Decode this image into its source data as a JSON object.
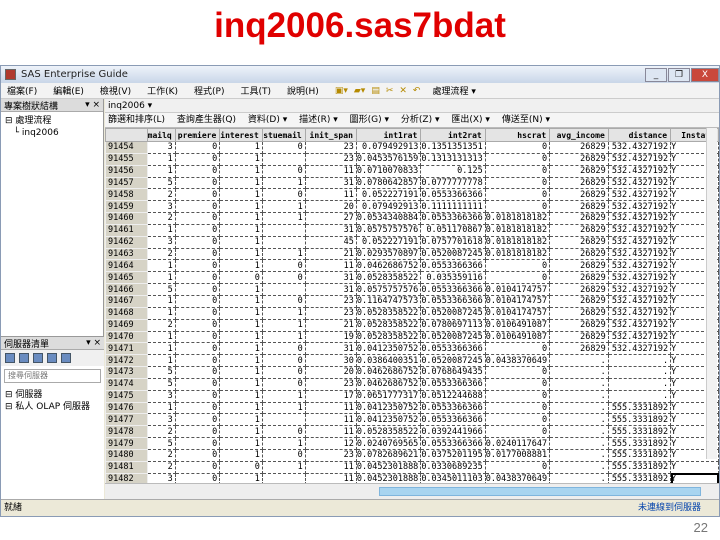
{
  "slide": {
    "title": "inq2006.sas7bdat",
    "page": "22"
  },
  "window": {
    "title": "SAS Enterprise Guide",
    "min": "_",
    "restore": "❐",
    "close": "X"
  },
  "menu": [
    "檔案(F)",
    "編輯(E)",
    "檢視(V)",
    "工作(K)",
    "程式(P)",
    "工具(T)",
    "說明(H)"
  ],
  "toolbar": {
    "flow_label": "處理流程 ▾"
  },
  "project_panel": {
    "title": "專案樹狀結構",
    "tree": [
      {
        "label": "處理流程",
        "prefix": "⊟ "
      },
      {
        "label": "inq2006",
        "prefix": "   └ "
      }
    ]
  },
  "server_panel": {
    "title": "伺服器清單",
    "search": "搜尋伺服器",
    "items": [
      "伺服器",
      "私人 OLAP 伺服器"
    ]
  },
  "tab": "inq2006 ▾",
  "data_toolbar": [
    "篩選和排序(L)",
    "查詢產生器(Q)",
    "資料(D) ▾",
    "描述(R) ▾",
    "圖形(G) ▾",
    "分析(Z) ▾",
    "匯出(X) ▾",
    "傳送至(N) ▾"
  ],
  "table": {
    "columns": [
      "",
      "mailq",
      "premiere",
      "interest",
      "stuemail",
      "init_span",
      "int1rat",
      "int2rat",
      "hscrat",
      "avg_income",
      "distance",
      "Instate"
    ],
    "rows": [
      [
        "91454",
        "3",
        "0",
        "1",
        "0",
        "23",
        "0.079492913",
        "0.1351351351",
        "0",
        "26829",
        "532.4327192",
        "Y"
      ],
      [
        "91455",
        "1",
        "0",
        "1",
        "",
        "23",
        "0.0453576159",
        "0.1313131313",
        "0",
        "26829",
        "532.4327192",
        "Y"
      ],
      [
        "91456",
        "1",
        "0",
        "1",
        "0",
        "11",
        "0.0710070833",
        "0.125",
        "0",
        "26829",
        "532.4327192",
        "Y"
      ],
      [
        "91457",
        "5",
        "0",
        "1",
        "1",
        "31",
        "0.0780642857",
        "0.0777777778",
        "0",
        "26829",
        "532.4327192",
        "Y"
      ],
      [
        "91458",
        "2",
        "0",
        "1",
        "0",
        "11",
        "0.052227191",
        "0.0553366366",
        "0",
        "26829",
        "532.4327192",
        "Y"
      ],
      [
        "91459",
        "3",
        "0",
        "1",
        "1",
        "20",
        "0.079492913",
        "0.1111111111",
        "0",
        "26829",
        "532.4327192",
        "Y"
      ],
      [
        "91460",
        "2",
        "0",
        "1",
        "1",
        "27",
        "0.0534340884",
        "0.0553366366",
        "0.0181818182",
        "26829",
        "532.4327192",
        "Y"
      ],
      [
        "91461",
        "1",
        "0",
        "1",
        "",
        "31",
        "0.0575757576",
        "0.051170867",
        "0.0181818182",
        "26829",
        "532.4327192",
        "Y"
      ],
      [
        "91462",
        "3",
        "0",
        "1",
        "",
        "45",
        "0.052227191",
        "0.0757701618",
        "0.0181818182",
        "26829",
        "532.4327192",
        "Y"
      ],
      [
        "91463",
        "2",
        "0",
        "1",
        "1",
        "21",
        "0.0293570897",
        "0.0520087245",
        "0.0181818182",
        "26829",
        "532.4327192",
        "Y"
      ],
      [
        "91464",
        "1",
        "0",
        "1",
        "0",
        "11",
        "0.0462686752",
        "0.0553366366",
        "0",
        "26829",
        "532.4327192",
        "Y"
      ],
      [
        "91465",
        "1",
        "0",
        "0",
        "0",
        "31",
        "0.0528358522",
        "0.035359116",
        "0",
        "26829",
        "532.4327192",
        "Y"
      ],
      [
        "91466",
        "5",
        "0",
        "1",
        "",
        "31",
        "0.0575757576",
        "0.0553366366",
        "0.0104174757",
        "26829",
        "532.4327192",
        "Y"
      ],
      [
        "91467",
        "1",
        "0",
        "1",
        "0",
        "23",
        "0.1164747573",
        "0.0553366366",
        "0.0104174757",
        "26829",
        "532.4327192",
        "Y"
      ],
      [
        "91468",
        "1",
        "0",
        "1",
        "1",
        "23",
        "0.0528358522",
        "0.0520087245",
        "0.0104174757",
        "26829",
        "532.4327192",
        "Y"
      ],
      [
        "91469",
        "2",
        "0",
        "1",
        "1",
        "21",
        "0.0528358522",
        "0.0780697113",
        "0.0106491087",
        "26829",
        "532.4327192",
        "Y"
      ],
      [
        "91470",
        "1",
        "0",
        "1",
        "1",
        "19",
        "0.0528358522",
        "0.0520087245",
        "0.0106491087",
        "26829",
        "532.4327192",
        "Y"
      ],
      [
        "91471",
        "1",
        "0",
        "1",
        "0",
        "31",
        "0.0412350752",
        "0.0553366366",
        "0",
        "26829",
        "532.4327192",
        "Y"
      ],
      [
        "91472",
        "1",
        "0",
        "1",
        "0",
        "30",
        "0.0386400351",
        "0.0520087245",
        "0.0438370649",
        ".",
        ".",
        "Y"
      ],
      [
        "91473",
        "5",
        "0",
        "1",
        "0",
        "20",
        "0.0462686752",
        "0.0768649435",
        "0",
        ".",
        ".",
        "Y"
      ],
      [
        "91474",
        "5",
        "0",
        "1",
        "0",
        "23",
        "0.0462686752",
        "0.0553366366",
        "0",
        ".",
        ".",
        "Y"
      ],
      [
        "91475",
        "3",
        "0",
        "1",
        "1",
        "17",
        "0.0651777317",
        "0.0512244688",
        "0",
        ".",
        ".",
        "Y"
      ],
      [
        "91476",
        "1",
        "0",
        "1",
        "1",
        "11",
        "0.0412350752",
        "0.0553366366",
        "0",
        ".",
        "555.3331892",
        "Y"
      ],
      [
        "91477",
        "3",
        "0",
        "1",
        "",
        "11",
        "0.0412350752",
        "0.0553366366",
        "0",
        ".",
        "555.3331892",
        "Y"
      ],
      [
        "91478",
        "2",
        "0",
        "1",
        "0",
        "11",
        "0.0528358522",
        "0.0392441966",
        "0",
        ".",
        "555.3331892",
        "Y"
      ],
      [
        "91479",
        "5",
        "0",
        "1",
        "1",
        "12",
        "0.0240769565",
        "0.0553366366",
        "0.0240117647",
        ".",
        "555.3331892",
        "Y"
      ],
      [
        "91480",
        "2",
        "0",
        "1",
        "0",
        "23",
        "0.0782689621",
        "0.0375201195",
        "0.0177008881",
        ".",
        "555.3331892",
        "Y"
      ],
      [
        "91481",
        "2",
        "0",
        "0",
        "1",
        "11",
        "0.0452301888",
        "0.0330689235",
        "0",
        ".",
        "555.3331892",
        "Y"
      ],
      [
        "91482",
        "3",
        "0",
        "1",
        "",
        "11",
        "0.0452301888",
        "0.0345011103",
        "0.0438370649",
        ".",
        "555.3331892",
        "Y"
      ]
    ]
  },
  "status": {
    "left": "就緒",
    "right": "未連線到伺服器"
  },
  "colors": {
    "title": "#e00000",
    "row_header": "#d6d3c6",
    "scroll_thumb": "#a8d4f0"
  }
}
